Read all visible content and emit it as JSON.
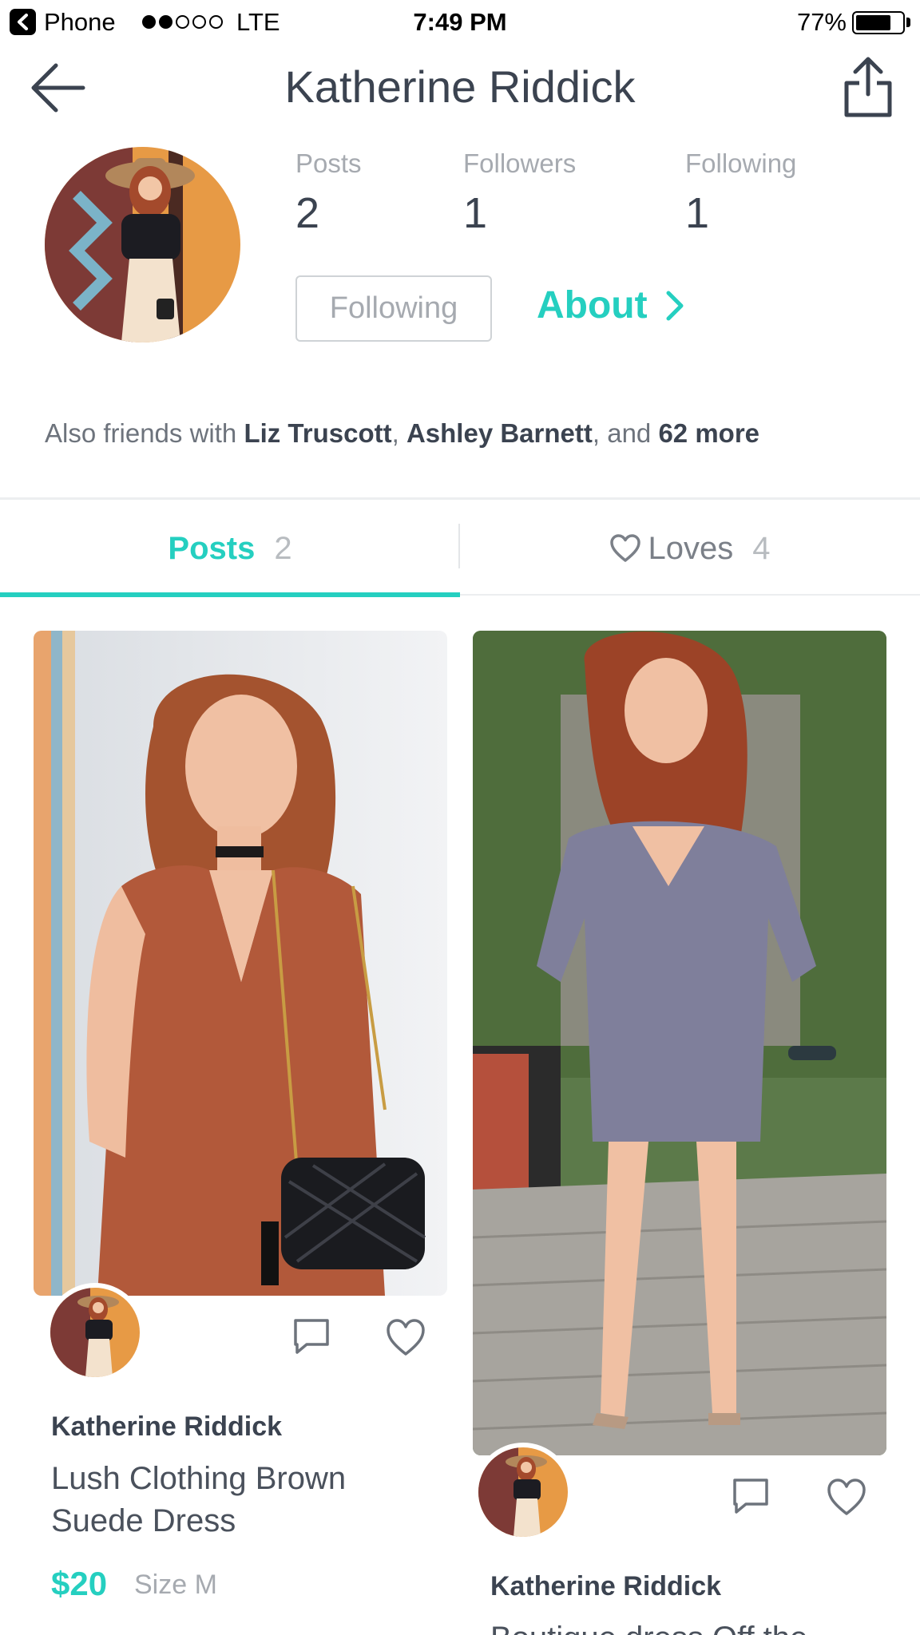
{
  "status_bar": {
    "carrier": "Phone",
    "network": "LTE",
    "time": "7:49 PM",
    "battery": "77%",
    "battery_level": 0.77,
    "signal_bars": 2
  },
  "header": {
    "title": "Katherine Riddick",
    "back_icon": "arrow-left-icon",
    "share_icon": "share-icon"
  },
  "profile": {
    "stats": [
      {
        "label": "Posts",
        "value": "2"
      },
      {
        "label": "Followers",
        "value": "1"
      },
      {
        "label": "Following",
        "value": "1"
      }
    ],
    "follow_button": "Following",
    "about_link": "About",
    "friends": {
      "prefix": "Also friends with ",
      "friend1": "Liz Truscott",
      "separator": ", ",
      "friend2": "Ashley Barnett",
      "middle": ", and ",
      "more": "62 more"
    }
  },
  "tabs": [
    {
      "label": "Posts",
      "count": "2",
      "active": true
    },
    {
      "label": "Loves",
      "count": "4",
      "active": false,
      "icon": "heart-icon"
    }
  ],
  "posts": [
    {
      "author": "Katherine Riddick",
      "title_line1": "Lush Clothing Brown",
      "title_line2": "Suede Dress",
      "price": "$20",
      "size": "Size M",
      "icons": [
        "comment-icon",
        "heart-icon"
      ]
    },
    {
      "author": "Katherine Riddick",
      "title_line1": "Boutique dress Off the",
      "icons": [
        "comment-icon",
        "heart-icon"
      ]
    }
  ],
  "colors": {
    "accent": "#25cfc0",
    "text_dark": "#3b4350",
    "text_muted": "#a6aab0"
  }
}
